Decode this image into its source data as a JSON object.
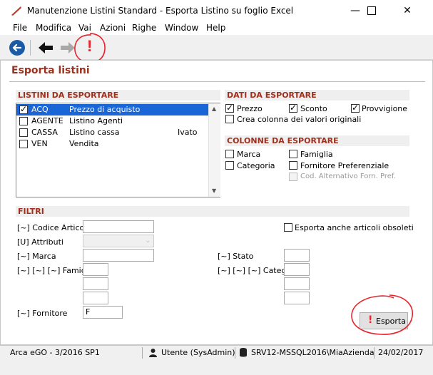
{
  "window": {
    "title": "Manutenzione Listini Standard  - Esporta Listino su foglio Excel"
  },
  "menu": [
    "File",
    "Modifica",
    "Vai",
    "Azioni",
    "Righe",
    "Window",
    "Help"
  ],
  "page": {
    "title": "Esporta listini"
  },
  "listini": {
    "header": "LISTINI DA ESPORTARE",
    "items": [
      {
        "code": "ACQ",
        "name": "Prezzo di acquisto",
        "note": "",
        "checked": true,
        "selected": true
      },
      {
        "code": "AGENTE",
        "name": "Listino Agenti",
        "note": "",
        "checked": false,
        "selected": false
      },
      {
        "code": "CASSA",
        "name": "Listino cassa",
        "note": "Ivato",
        "checked": false,
        "selected": false
      },
      {
        "code": "VEN",
        "name": "Vendita",
        "note": "",
        "checked": false,
        "selected": false
      }
    ]
  },
  "dati": {
    "header": "DATI DA ESPORTARE",
    "prezzo": "Prezzo",
    "sconto": "Sconto",
    "provvigione": "Provvigione",
    "crea_colonna": "Crea colonna dei valori originali"
  },
  "colonne": {
    "header": "COLONNE DA ESPORTARE",
    "marca": "Marca",
    "famiglia": "Famiglia",
    "categoria": "Categoria",
    "fornitore_pref": "Fornitore Preferenziale",
    "cod_alternativo": "Cod. Alternativo Forn. Pref."
  },
  "filtri": {
    "header": "FILTRI",
    "codice_articolo": "[~] Codice Articolo",
    "attributi": "[U] Attributi",
    "marca": "[~] Marca",
    "famiglia": "[~] [~] [~] Famiglia",
    "fornitore": "[~] Fornitore",
    "fornitore_value": "F",
    "obsoleti": "Esporta anche articoli obsoleti",
    "stato": "[~] Stato",
    "categoria": "[~] [~] [~] Categoria"
  },
  "buttons": {
    "esporta": "Esporta",
    "exclamation": "!"
  },
  "status": {
    "app": "Arca eGO - 3/2016 SP1",
    "user": "Utente (SysAdmin)",
    "db": "SRV12-MSSQL2016\\MiaAzienda",
    "date": "24/02/2017"
  },
  "colors": {
    "accent": "#a0301e",
    "selection": "#1a66d6",
    "annotation": "#e8232a"
  }
}
